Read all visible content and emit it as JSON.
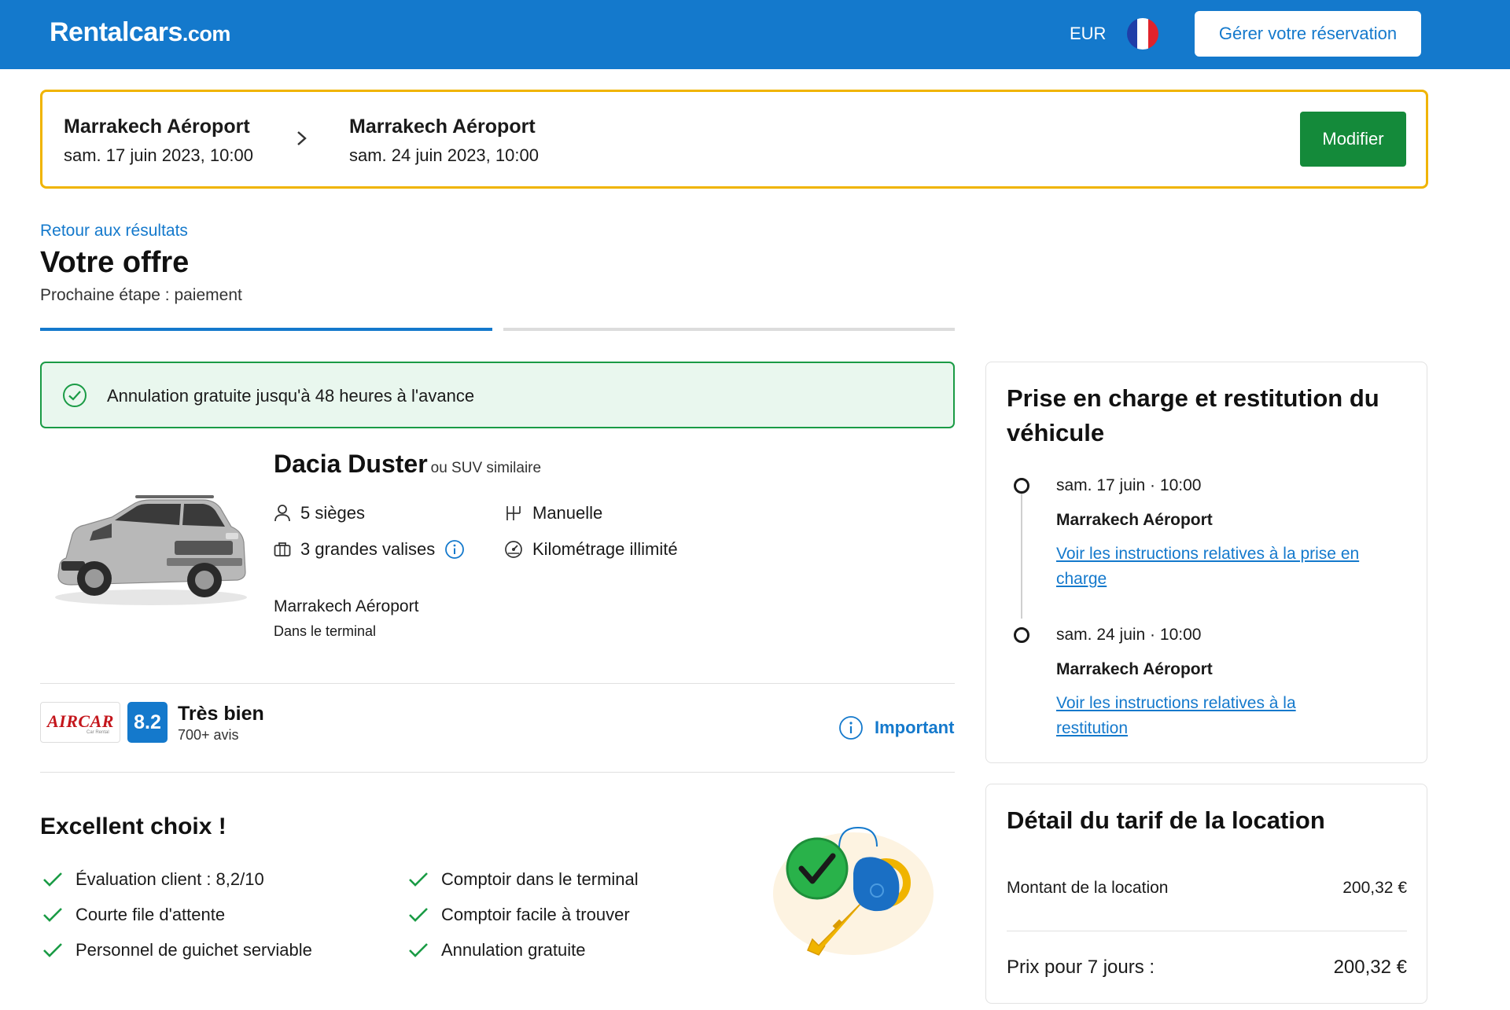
{
  "header": {
    "logo_main": "Rentalcars",
    "logo_suffix": ".com",
    "currency": "EUR",
    "manage_booking": "Gérer votre réservation"
  },
  "search": {
    "pickup_location": "Marrakech Aéroport",
    "pickup_date": "sam. 17 juin 2023, 10:00",
    "dropoff_location": "Marrakech Aéroport",
    "dropoff_date": "sam. 24 juin 2023, 10:00",
    "modify_label": "Modifier"
  },
  "offer": {
    "back_link": "Retour aux résultats",
    "title": "Votre offre",
    "next_step": "Prochaine étape : paiement"
  },
  "cancellation": {
    "text": "Annulation gratuite jusqu'à 48 heures à l'avance"
  },
  "car": {
    "name": "Dacia Duster",
    "similar": "ou SUV similaire",
    "seats": "5 sièges",
    "bags": "3 grandes valises",
    "transmission": "Manuelle",
    "mileage": "Kilométrage illimité",
    "pickup_location": "Marrakech Aéroport",
    "pickup_detail": "Dans le terminal"
  },
  "supplier": {
    "brand": "AIRCAR",
    "brand_sub": "Car Rental",
    "score": "8.2",
    "rating_word": "Très bien",
    "review_count": "700+ avis",
    "important_label": "Important"
  },
  "excellent": {
    "title": "Excellent choix !",
    "items_left": [
      "Évaluation client : 8,2/10",
      "Courte file d'attente",
      "Personnel de guichet serviable"
    ],
    "items_right": [
      "Comptoir dans le terminal",
      "Comptoir facile à trouver",
      "Annulation gratuite"
    ]
  },
  "pickup_panel": {
    "title_line1": "Prise en charge et restitution du",
    "title_line2": "véhicule",
    "pickup_date": "sam. 17 juin · 10:00",
    "pickup_location": "Marrakech Aéroport",
    "pickup_link": "Voir les instructions relatives à la prise en charge",
    "return_date": "sam. 24 juin · 10:00",
    "return_location": "Marrakech Aéroport",
    "return_link": "Voir les instructions relatives à la restitution"
  },
  "price_panel": {
    "title": "Détail du tarif de la location",
    "rental_label": "Montant de la location",
    "rental_amount": "200,32 €",
    "total_label": "Prix pour 7 jours :",
    "total_amount": "200,32 €"
  },
  "colors": {
    "brand_blue": "#1479cc",
    "action_green": "#148a3a",
    "highlight_yellow": "#f0b400",
    "success_green": "#1a9b45"
  },
  "progress": {
    "current_step": 1,
    "total_steps": 2
  }
}
